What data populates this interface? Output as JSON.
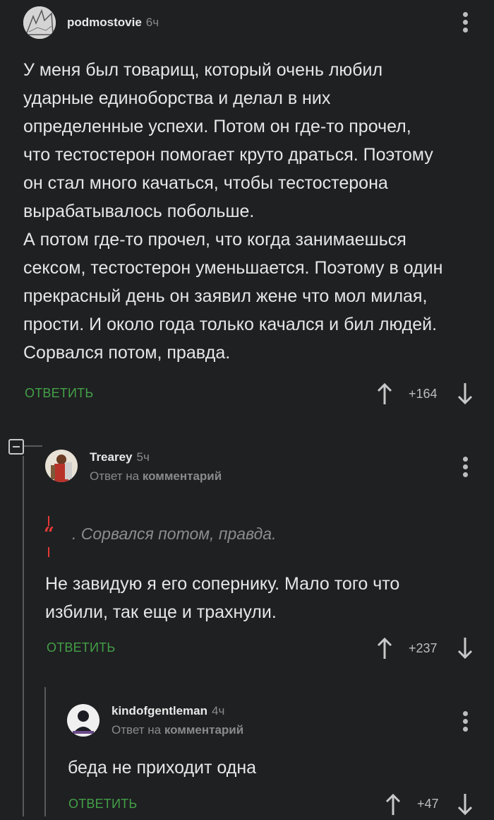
{
  "comments": [
    {
      "username": "podmostovie",
      "time": "6ч",
      "text": [
        "У меня был товарищ, который очень любил",
        "ударные единоборства и делал в них",
        "определенные успехи. Потом он где-то прочел,",
        "что тестостерон помогает круто драться. Поэтому",
        "он стал много качаться, чтобы тестостерона",
        "вырабатывалось побольше.",
        "А потом где-то прочел, что когда занимаешься",
        "сексом, тестостерон уменьшается. Поэтому в один",
        "прекрасный день он заявил жене что мол милая,",
        "прости. И около года только качался и бил людей.",
        "Сорвался потом, правда."
      ],
      "reply_label": "ответить",
      "rating": "+164"
    },
    {
      "username": "Trearey",
      "time": "5ч",
      "reply_prefix": "Ответ на",
      "reply_target": "комментарий",
      "quote": ". Сорвался потом, правда.",
      "text": [
        "Не завидую я его сопернику. Мало того что",
        "избили, так еще и трахнули."
      ],
      "reply_label": "ответить",
      "rating": "+237"
    },
    {
      "username": "kindofgentleman",
      "time": "4ч",
      "reply_prefix": "Ответ на",
      "reply_target": "комментарий",
      "text": [
        "беда не приходит одна"
      ],
      "reply_label": "ответить",
      "rating": "+47"
    }
  ],
  "colors": {
    "background": "#1f2022",
    "accent": "#43a047",
    "muted": "#8a8a8a",
    "quote_mark": "#e53935"
  },
  "icons": [
    "more-vertical-icon",
    "arrow-up-icon",
    "arrow-down-icon",
    "collapse-icon",
    "quote-icon"
  ]
}
